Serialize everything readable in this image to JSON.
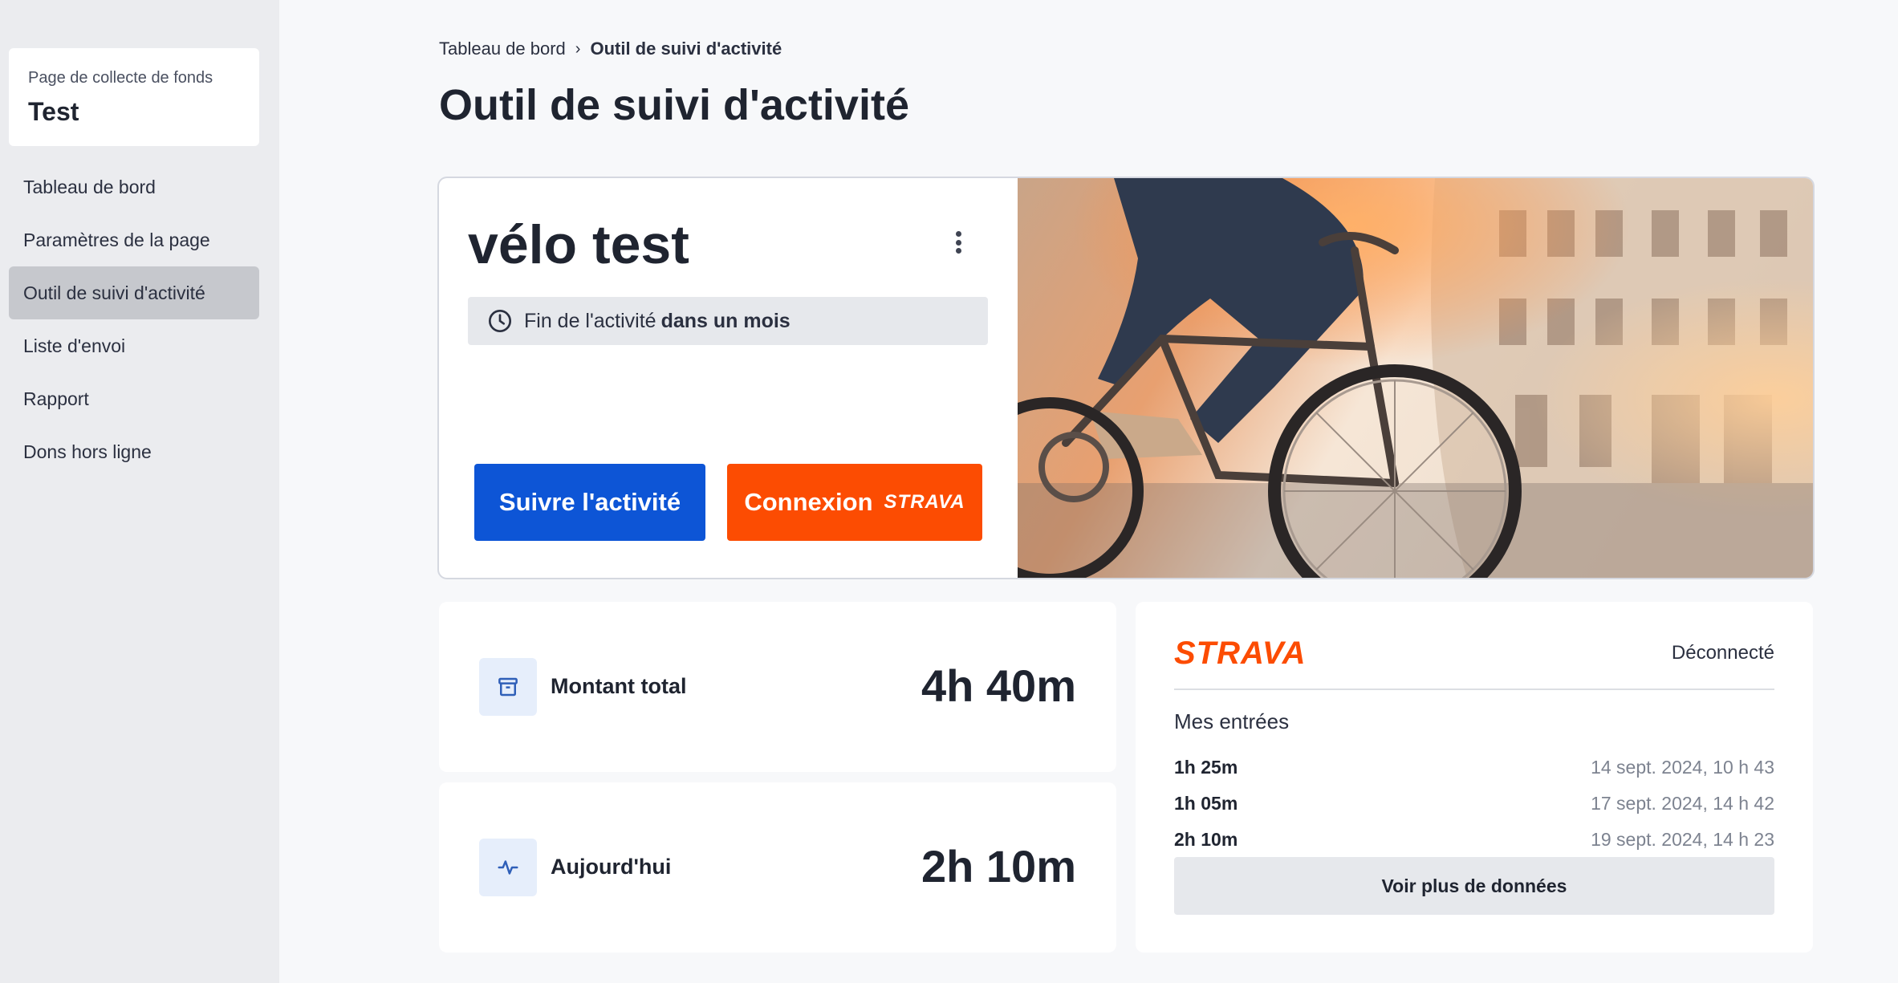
{
  "sidebar": {
    "page_card": {
      "subtitle": "Page de collecte de fonds",
      "name": "Test"
    },
    "items": [
      {
        "label": "Tableau de bord"
      },
      {
        "label": "Paramètres de la page"
      },
      {
        "label": "Outil de suivi d'activité",
        "active": true
      },
      {
        "label": "Liste d'envoi"
      },
      {
        "label": "Rapport"
      },
      {
        "label": "Dons hors ligne"
      }
    ]
  },
  "breadcrumb": {
    "parent": "Tableau de bord",
    "separator": "›",
    "current": "Outil de suivi d'activité"
  },
  "page_title": "Outil de suivi d'activité",
  "activity": {
    "name": "vélo test",
    "end_prefix": "Fin de l'activité",
    "end_value": "dans un mois",
    "follow_button": "Suivre l'activité",
    "connect_button": "Connexion",
    "connect_logo": "STRAVA"
  },
  "stats": {
    "total": {
      "label": "Montant total",
      "value": "4h 40m",
      "icon": "archive-box-icon"
    },
    "today": {
      "label": "Aujourd'hui",
      "value": "2h 10m",
      "icon": "pulse-icon"
    }
  },
  "strava": {
    "logo": "STRAVA",
    "status": "Déconnecté",
    "entries_title": "Mes entrées",
    "entries": [
      {
        "duration": "1h 25m",
        "date": "14 sept. 2024, 10 h 43"
      },
      {
        "duration": "1h 05m",
        "date": "17 sept. 2024, 14 h 42"
      },
      {
        "duration": "2h 10m",
        "date": "19 sept. 2024, 14 h 23"
      }
    ],
    "more_button": "Voir plus de données"
  },
  "colors": {
    "primary": "#0d55d6",
    "strava": "#fc4c02",
    "sidebar_bg": "#ebecef",
    "page_bg": "#f7f8fa"
  }
}
